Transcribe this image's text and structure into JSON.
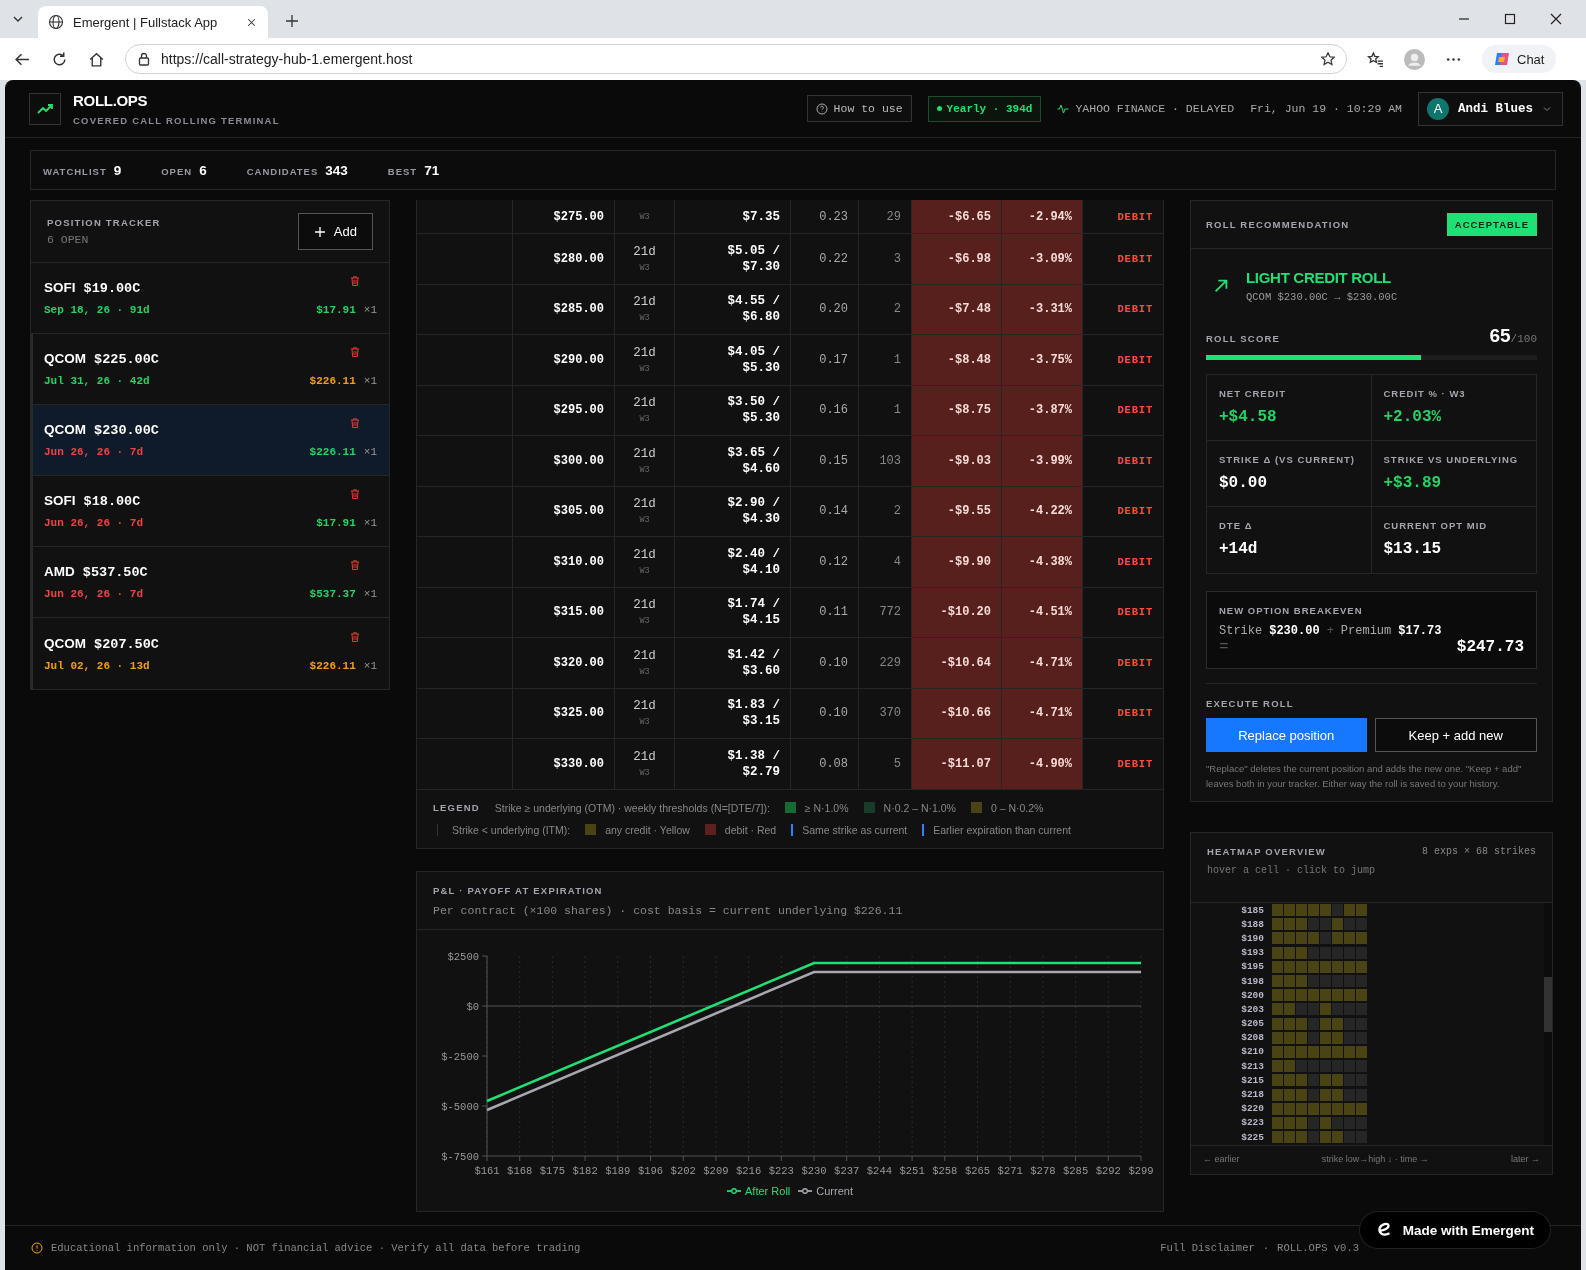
{
  "browser": {
    "tab_title": "Emergent | Fullstack App",
    "url": "https://call-strategy-hub-1.emergent.host",
    "chat_label": "Chat"
  },
  "header": {
    "brand": "ROLL.OPS",
    "tagline": "COVERED CALL ROLLING TERMINAL",
    "help_button": "How to use",
    "mode": "Yearly · 394d",
    "source": "YAHOO FINANCE · DELAYED",
    "datetime": "Fri, Jun 19 · 10:29 AM",
    "user": {
      "initial": "A",
      "name": "Andi Blues"
    }
  },
  "stats": [
    {
      "label": "WATCHLIST",
      "value": "9"
    },
    {
      "label": "OPEN",
      "value": "6"
    },
    {
      "label": "CANDIDATES",
      "value": "343"
    },
    {
      "label": "BEST",
      "value": "71"
    }
  ],
  "tracker": {
    "title": "POSITION TRACKER",
    "count": "6 OPEN",
    "add_button": "Add",
    "positions": [
      {
        "ticker": "SOFI",
        "strike": "$19.00C",
        "expiry": {
          "text": "Sep 18, 26 · 91d",
          "color": "#22d366"
        },
        "price": {
          "text": "$17.91",
          "color": "#22d366"
        },
        "qty": "×1",
        "selected": false
      },
      {
        "ticker": "QCOM",
        "strike": "$225.00C",
        "expiry": {
          "text": "Jul 31, 26 · 42d",
          "color": "#22d366"
        },
        "price": {
          "text": "$226.11",
          "color": "#f59e0b"
        },
        "qty": "×1",
        "selected": false
      },
      {
        "ticker": "QCOM",
        "strike": "$230.00C",
        "expiry": {
          "text": "Jun 26, 26 · 7d",
          "color": "#ef4444"
        },
        "price": {
          "text": "$226.11",
          "color": "#22d366"
        },
        "qty": "×1",
        "selected": true
      },
      {
        "ticker": "SOFI",
        "strike": "$18.00C",
        "expiry": {
          "text": "Jun 26, 26 · 7d",
          "color": "#ef4444"
        },
        "price": {
          "text": "$17.91",
          "color": "#22d366"
        },
        "qty": "×1",
        "selected": false
      },
      {
        "ticker": "AMD",
        "strike": "$537.50C",
        "expiry": {
          "text": "Jun 26, 26 · 7d",
          "color": "#ef4444"
        },
        "price": {
          "text": "$537.37",
          "color": "#22d366"
        },
        "qty": "×1",
        "selected": false
      },
      {
        "ticker": "QCOM",
        "strike": "$207.50C",
        "expiry": {
          "text": "Jul 02, 26 · 13d",
          "color": "#f59e0b"
        },
        "price": {
          "text": "$226.11",
          "color": "#f59e0b"
        },
        "qty": "×1",
        "selected": false
      }
    ]
  },
  "table": {
    "rows": [
      {
        "kind": "debit",
        "strike": "$275.00",
        "week": "W3",
        "ask": "$7.35",
        "delta": "0.23",
        "oi": "29",
        "net": "-$6.65",
        "pct": "-2.94%",
        "action": "DEBIT"
      },
      {
        "kind": "debit",
        "strike": "$280.00",
        "dte": "21d",
        "week": "W3",
        "bid": "$5.05 /",
        "ask": "$7.30",
        "delta": "0.22",
        "oi": "3",
        "net": "-$6.98",
        "pct": "-3.09%",
        "action": "DEBIT"
      },
      {
        "kind": "debit",
        "strike": "$285.00",
        "dte": "21d",
        "week": "W3",
        "bid": "$4.55 /",
        "ask": "$6.80",
        "delta": "0.20",
        "oi": "2",
        "net": "-$7.48",
        "pct": "-3.31%",
        "action": "DEBIT"
      },
      {
        "kind": "debit",
        "strike": "$290.00",
        "dte": "21d",
        "week": "W3",
        "bid": "$4.05 /",
        "ask": "$5.30",
        "delta": "0.17",
        "oi": "1",
        "net": "-$8.48",
        "pct": "-3.75%",
        "action": "DEBIT"
      },
      {
        "kind": "debit",
        "strike": "$295.00",
        "dte": "21d",
        "week": "W3",
        "bid": "$3.50 /",
        "ask": "$5.30",
        "delta": "0.16",
        "oi": "1",
        "net": "-$8.75",
        "pct": "-3.87%",
        "action": "DEBIT"
      },
      {
        "kind": "debit",
        "strike": "$300.00",
        "dte": "21d",
        "week": "W3",
        "bid": "$3.65 /",
        "ask": "$4.60",
        "delta": "0.15",
        "oi": "103",
        "net": "-$9.03",
        "pct": "-3.99%",
        "action": "DEBIT"
      },
      {
        "kind": "debit",
        "strike": "$305.00",
        "dte": "21d",
        "week": "W3",
        "bid": "$2.90 /",
        "ask": "$4.30",
        "delta": "0.14",
        "oi": "2",
        "net": "-$9.55",
        "pct": "-4.22%",
        "action": "DEBIT"
      },
      {
        "kind": "debit",
        "strike": "$310.00",
        "dte": "21d",
        "week": "W3",
        "bid": "$2.40 /",
        "ask": "$4.10",
        "delta": "0.12",
        "oi": "4",
        "net": "-$9.90",
        "pct": "-4.38%",
        "action": "DEBIT"
      },
      {
        "kind": "debit",
        "strike": "$315.00",
        "dte": "21d",
        "week": "W3",
        "bid": "$1.74 /",
        "ask": "$4.15",
        "delta": "0.11",
        "oi": "772",
        "net": "-$10.20",
        "pct": "-4.51%",
        "action": "DEBIT"
      },
      {
        "kind": "debit",
        "strike": "$320.00",
        "dte": "21d",
        "week": "W3",
        "bid": "$1.42 /",
        "ask": "$3.60",
        "delta": "0.10",
        "oi": "229",
        "net": "-$10.64",
        "pct": "-4.71%",
        "action": "DEBIT"
      },
      {
        "kind": "debit",
        "strike": "$325.00",
        "dte": "21d",
        "week": "W3",
        "bid": "$1.83 /",
        "ask": "$3.15",
        "delta": "0.10",
        "oi": "370",
        "net": "-$10.66",
        "pct": "-4.71%",
        "action": "DEBIT"
      },
      {
        "kind": "debit",
        "strike": "$330.00",
        "dte": "21d",
        "week": "W3",
        "bid": "$1.38 /",
        "ask": "$2.79",
        "delta": "0.08",
        "oi": "5",
        "net": "-$11.07",
        "pct": "-4.90%",
        "action": "DEBIT"
      }
    ]
  },
  "table_legend": {
    "title": "LEGEND",
    "lines": [
      {
        "caption": "Strike ≥ underlying (OTM) · weekly thresholds (N=[DTE/7]):",
        "items": [
          {
            "kind": "swatch",
            "label": "≥ N·1.0%",
            "color": "#166b34"
          },
          {
            "kind": "swatch",
            "label": "N·0.2 – N·1.0%",
            "color": "#173d2a"
          },
          {
            "kind": "swatch",
            "label": "0 – N·0.2%",
            "color": "#4a4314"
          }
        ]
      },
      {
        "caption": "Strike < underlying (ITM):",
        "items": [
          {
            "kind": "swatch",
            "label": "any credit · Yellow",
            "color": "#4a4314"
          },
          {
            "kind": "swatch",
            "label": "debit · Red",
            "color": "#5c211e"
          },
          {
            "kind": "bar",
            "label": "Same strike as current",
            "color": "#2f80ff"
          },
          {
            "kind": "bar",
            "label": "Earlier expiration than current",
            "color": "#2f80ff"
          }
        ]
      }
    ]
  },
  "recommendation": {
    "title": "ROLL RECOMMENDATION",
    "verdict": "ACCEPTABLE",
    "headline": "LIGHT CREDIT ROLL",
    "route": "QCOM $230.00C → $230.00C",
    "score_label": "ROLL SCORE",
    "score": "65",
    "score_max": "/100",
    "level": 0.65,
    "metrics": [
      {
        "label": "NET CREDIT",
        "value": "+$4.58",
        "color": "#22d366"
      },
      {
        "label": "CREDIT % · W3",
        "value": "+2.03%",
        "color": "#22d366"
      },
      {
        "label": "STRIKE Δ (VS CURRENT)",
        "value": "$0.00",
        "color": "#ffffff"
      },
      {
        "label": "STRIKE VS UNDERLYING",
        "value": "+$3.89",
        "color": "#22d366"
      },
      {
        "label": "DTE Δ",
        "value": "+14d",
        "color": "#ffffff"
      },
      {
        "label": "CURRENT OPT MID",
        "value": "$13.15",
        "color": "#ffffff"
      }
    ],
    "breakeven": {
      "title": "NEW OPTION BREAKEVEN",
      "strike_label": "Strike",
      "strike": "$230.00",
      "plus": "+",
      "premium_label": "Premium",
      "premium": "$17.73",
      "equals": "=",
      "total": "$247.73"
    },
    "execute": {
      "title": "EXECUTE ROLL",
      "primary": "Replace position",
      "secondary": "Keep + add new",
      "note": "\"Replace\" deletes the current position and adds the new one. \"Keep + add\" leaves both in your tracker. Either way the roll is saved to your history."
    }
  },
  "pnl": {
    "title": "P&L · PAYOFF AT EXPIRATION",
    "subtitle": "Per contract (×100 shares) · cost basis = current underlying $226.11",
    "chart_data": {
      "type": "line",
      "x": [
        161,
        230,
        299
      ],
      "series": [
        {
          "name": "After Roll",
          "color": "#1fe074",
          "values": [
            -4750,
            2150,
            2150
          ]
        },
        {
          "name": "Current",
          "color": "#a8a8b0",
          "values": [
            -5200,
            1700,
            1700
          ]
        }
      ],
      "xlim": [
        161,
        299
      ],
      "ylim": [
        -7500,
        2500
      ],
      "grid": true,
      "legend": "bottom",
      "yticks": [
        {
          "value": 2500,
          "label": "$2500"
        },
        {
          "value": 0,
          "label": "$0"
        },
        {
          "value": -2500,
          "label": "$-2500"
        },
        {
          "value": -5000,
          "label": "$-5000"
        },
        {
          "value": -7500,
          "label": "$-7500"
        }
      ],
      "xticks": [
        {
          "value": 161,
          "label": "$161"
        },
        {
          "value": 167.9,
          "label": "$168"
        },
        {
          "value": 174.8,
          "label": "$175"
        },
        {
          "value": 181.7,
          "label": "$182"
        },
        {
          "value": 188.6,
          "label": "$189"
        },
        {
          "value": 195.5,
          "label": "$196"
        },
        {
          "value": 202.4,
          "label": "$202"
        },
        {
          "value": 209.3,
          "label": "$209"
        },
        {
          "value": 216.2,
          "label": "$216"
        },
        {
          "value": 223.1,
          "label": "$223"
        },
        {
          "value": 230,
          "label": "$230"
        },
        {
          "value": 236.9,
          "label": "$237"
        },
        {
          "value": 243.8,
          "label": "$244"
        },
        {
          "value": 250.7,
          "label": "$251"
        },
        {
          "value": 257.6,
          "label": "$258"
        },
        {
          "value": 264.5,
          "label": "$265"
        },
        {
          "value": 271.4,
          "label": "$271"
        },
        {
          "value": 278.3,
          "label": "$278"
        },
        {
          "value": 285.2,
          "label": "$285"
        },
        {
          "value": 292.1,
          "label": "$292"
        },
        {
          "value": 299,
          "label": "$299"
        }
      ]
    }
  },
  "heatmap": {
    "title": "HEATMAP OVERVIEW",
    "summary": "8 exps × 68 strikes",
    "hint": "hover a cell · click to jump",
    "rows": [
      {
        "strike": "$185",
        "cells": [
          true,
          true,
          true,
          true,
          true,
          false,
          true,
          true
        ]
      },
      {
        "strike": "$188",
        "cells": [
          true,
          true,
          true,
          false,
          false,
          true,
          false,
          false
        ]
      },
      {
        "strike": "$190",
        "cells": [
          true,
          true,
          true,
          true,
          false,
          true,
          true,
          true
        ]
      },
      {
        "strike": "$193",
        "cells": [
          true,
          true,
          true,
          false,
          false,
          false,
          false,
          false
        ]
      },
      {
        "strike": "$195",
        "cells": [
          true,
          true,
          true,
          true,
          true,
          true,
          true,
          true
        ]
      },
      {
        "strike": "$198",
        "cells": [
          true,
          true,
          true,
          false,
          false,
          false,
          false,
          false
        ]
      },
      {
        "strike": "$200",
        "cells": [
          true,
          true,
          true,
          true,
          true,
          true,
          true,
          true
        ]
      },
      {
        "strike": "$203",
        "cells": [
          true,
          true,
          false,
          false,
          true,
          false,
          false,
          false
        ]
      },
      {
        "strike": "$205",
        "cells": [
          true,
          true,
          true,
          false,
          true,
          true,
          false,
          false
        ]
      },
      {
        "strike": "$208",
        "cells": [
          true,
          true,
          true,
          false,
          true,
          true,
          false,
          false
        ]
      },
      {
        "strike": "$210",
        "cells": [
          true,
          true,
          true,
          true,
          true,
          true,
          true,
          true
        ]
      },
      {
        "strike": "$213",
        "cells": [
          true,
          true,
          false,
          false,
          false,
          false,
          false,
          false
        ]
      },
      {
        "strike": "$215",
        "cells": [
          true,
          true,
          true,
          false,
          true,
          true,
          false,
          false
        ]
      },
      {
        "strike": "$218",
        "cells": [
          true,
          true,
          true,
          false,
          true,
          true,
          false,
          false
        ]
      },
      {
        "strike": "$220",
        "cells": [
          true,
          true,
          true,
          true,
          true,
          true,
          true,
          true
        ]
      },
      {
        "strike": "$223",
        "cells": [
          true,
          true,
          true,
          false,
          true,
          false,
          false,
          false
        ]
      },
      {
        "strike": "$225",
        "cells": [
          true,
          true,
          true,
          false,
          true,
          true,
          false,
          false
        ]
      }
    ],
    "footer_left": "← earlier",
    "footer_center": "strike low→high ↓ · time →",
    "footer_right": "later →"
  },
  "footer": {
    "disclaimer": "Educational information only · NOT financial advice · Verify all data before trading",
    "link": "Full Disclaimer",
    "separator": "·",
    "version": "ROLL.OPS v0.3"
  },
  "badge": "Made with Emergent"
}
